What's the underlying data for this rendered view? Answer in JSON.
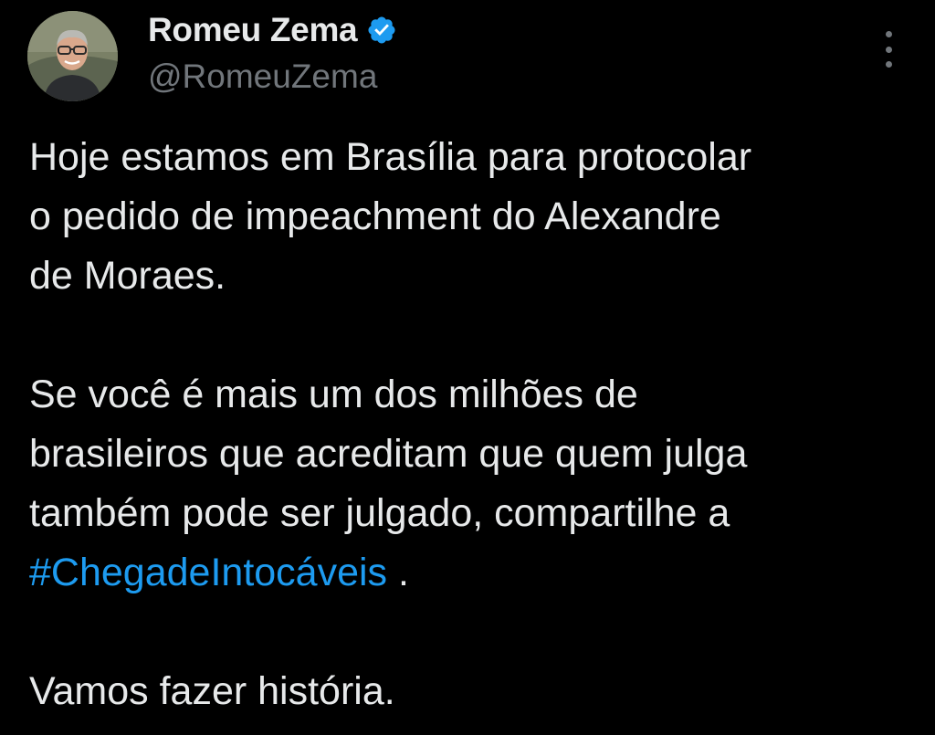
{
  "author": {
    "display_name": "Romeu Zema",
    "handle": "@RomeuZema",
    "verified": true,
    "avatar_icon": "profile-photo"
  },
  "menu": {
    "icon": "more-vertical-icon"
  },
  "tweet": {
    "paragraph1": "Hoje estamos em Brasília para protocolar\no pedido de impeachment do Alexandre\nde Moraes.",
    "paragraph2_text": "Se você é mais um dos milhões de\nbrasileiros que acreditam que quem julga\ntambém pode ser julgado, compartilhe a\n",
    "hashtag": "#ChegadeIntocáveis",
    "hashtag_suffix": " .",
    "paragraph3": "Vamos fazer história."
  },
  "colors": {
    "background": "#000000",
    "text": "#e7e9ea",
    "secondary": "#71767b",
    "accent": "#1d9bf0"
  }
}
